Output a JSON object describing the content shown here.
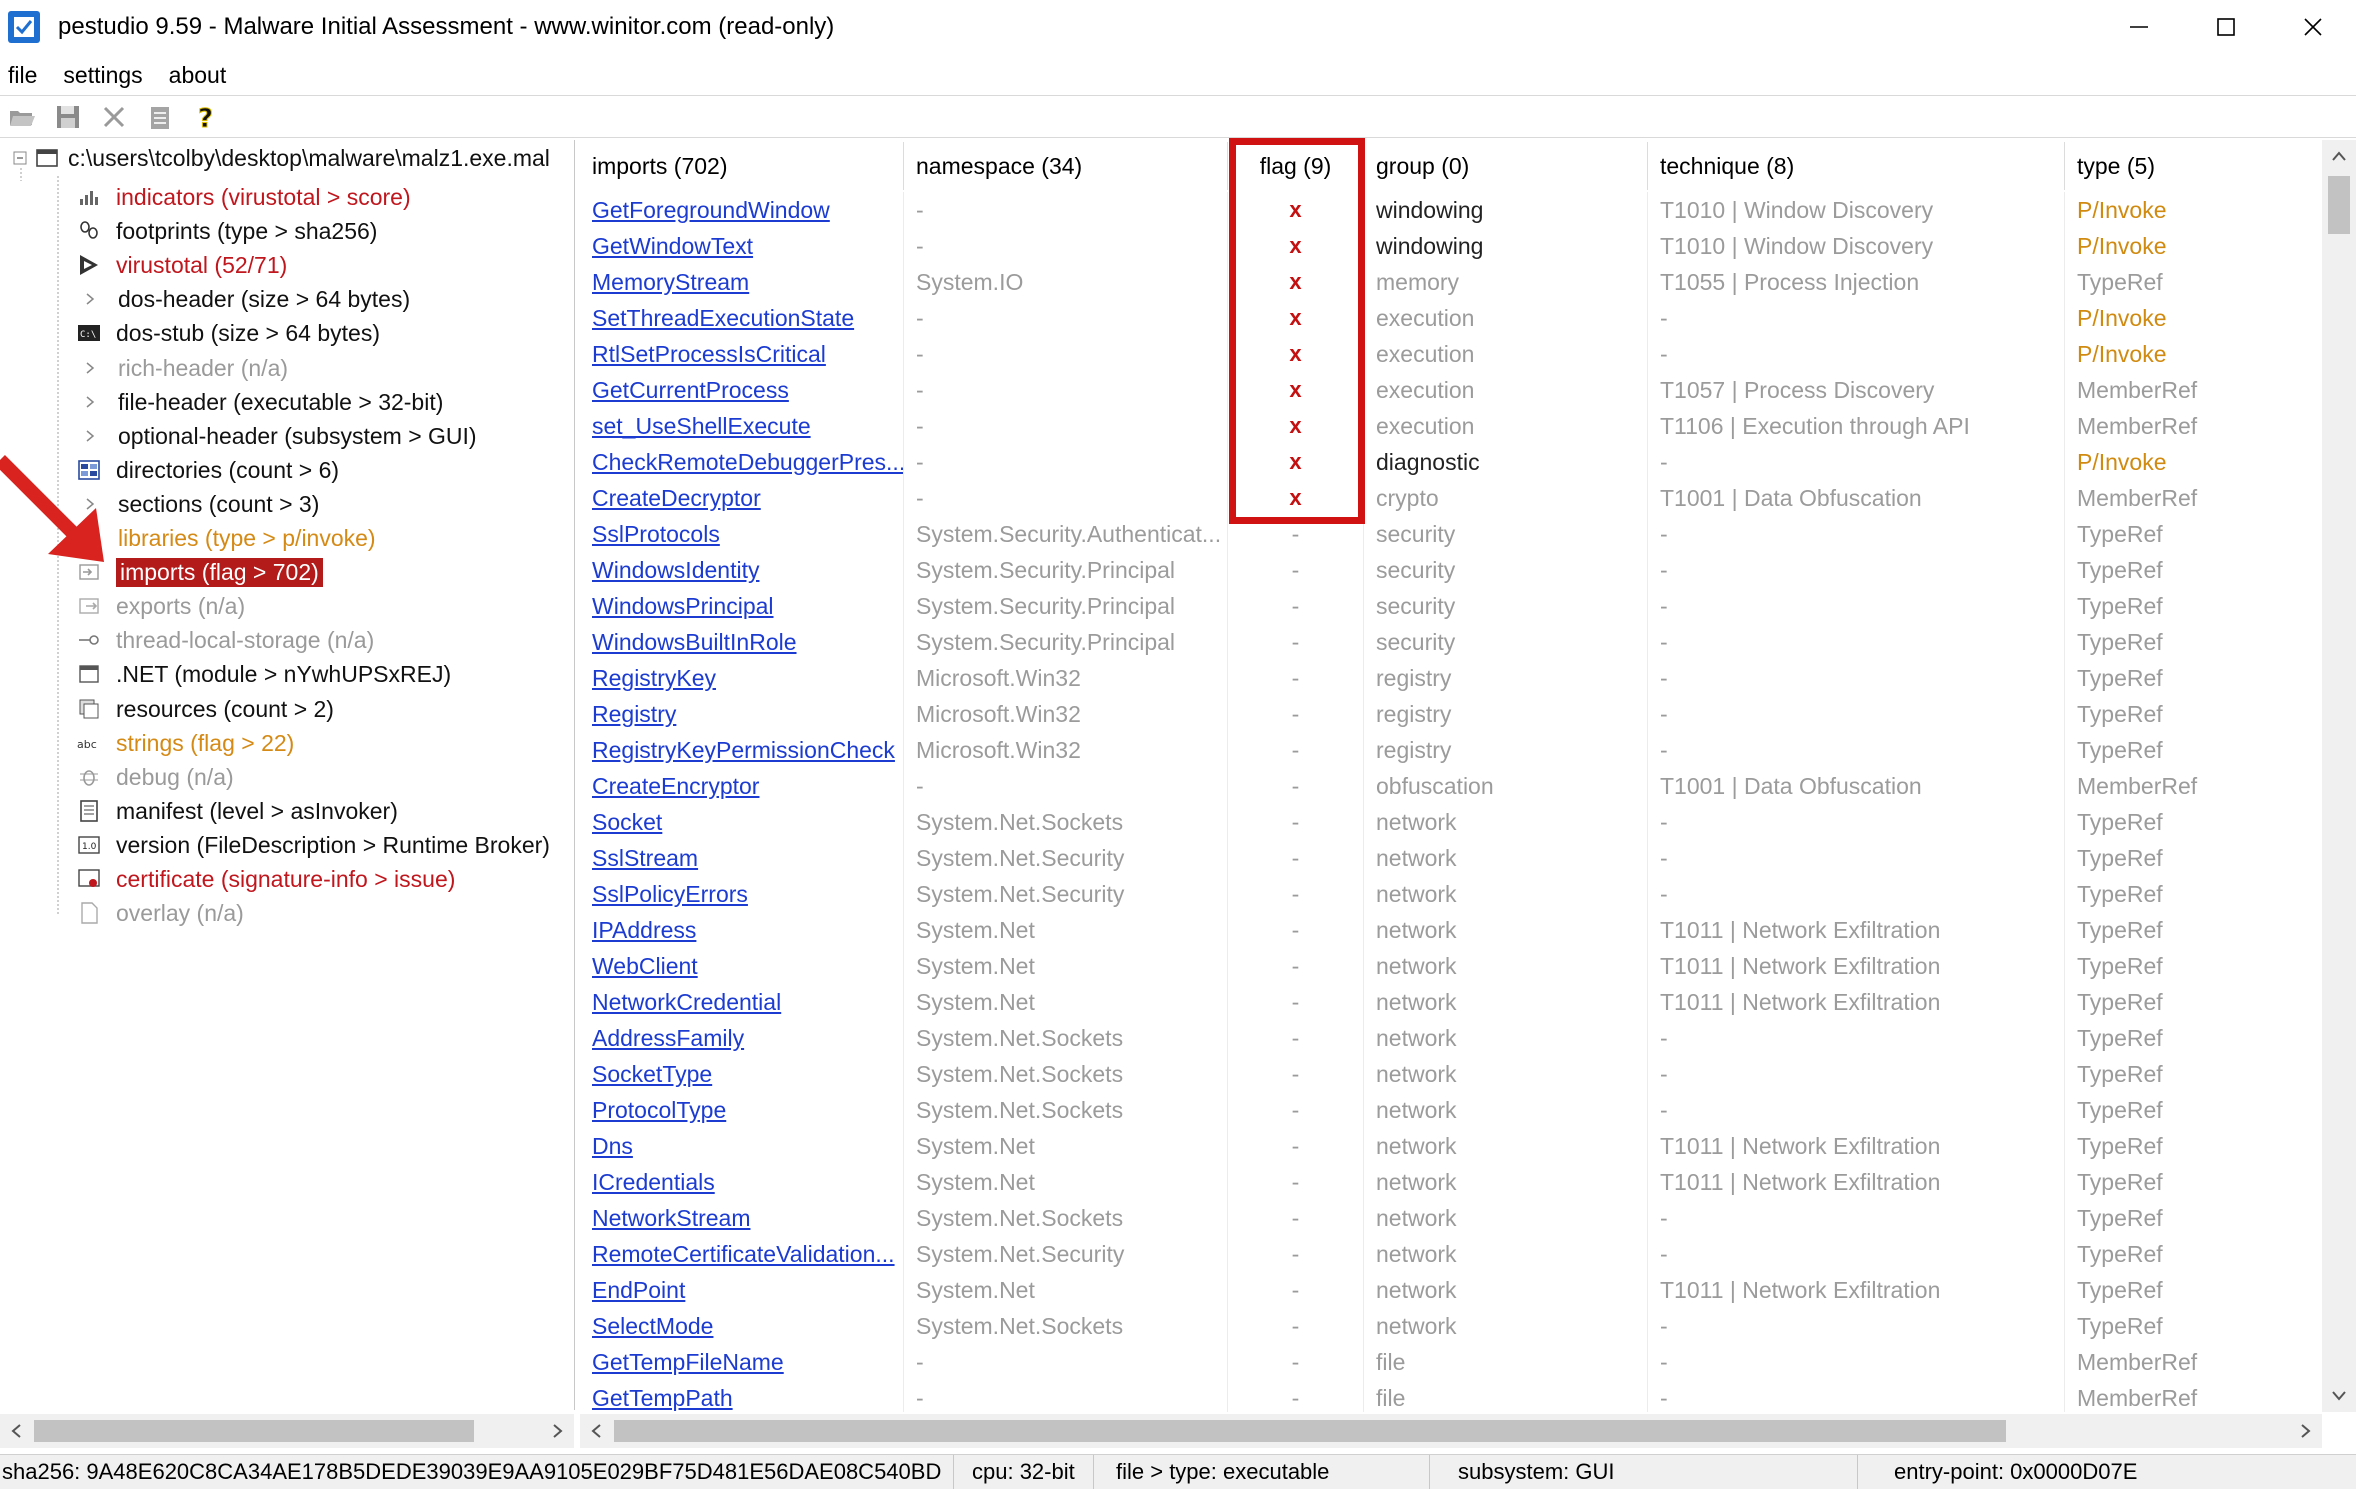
{
  "window": {
    "title": "pestudio 9.59 - Malware Initial Assessment - www.winitor.com (read-only)"
  },
  "menu": [
    "file",
    "settings",
    "about"
  ],
  "tree": {
    "root": "c:\\users\\tcolby\\desktop\\malware\\malz1.exe.mal",
    "items": [
      {
        "label": "indicators (virustotal > score)",
        "style": "red",
        "icon": "indicators-icon",
        "expander": false
      },
      {
        "label": "footprints (type > sha256)",
        "style": "black",
        "icon": "footprints-icon",
        "expander": false
      },
      {
        "label": "virustotal (52/71)",
        "style": "red",
        "icon": "virustotal-icon",
        "expander": false
      },
      {
        "label": "dos-header (size > 64 bytes)",
        "style": "black",
        "icon": "",
        "expander": true
      },
      {
        "label": "dos-stub (size > 64 bytes)",
        "style": "black",
        "icon": "dos-stub-icon",
        "expander": false
      },
      {
        "label": "rich-header (n/a)",
        "style": "gray",
        "icon": "",
        "expander": true
      },
      {
        "label": "file-header (executable > 32-bit)",
        "style": "black",
        "icon": "",
        "expander": true
      },
      {
        "label": "optional-header (subsystem > GUI)",
        "style": "black",
        "icon": "",
        "expander": true
      },
      {
        "label": "directories (count > 6)",
        "style": "black",
        "icon": "directories-icon",
        "expander": false
      },
      {
        "label": "sections (count > 3)",
        "style": "black",
        "icon": "",
        "expander": true
      },
      {
        "label": "libraries (type > p/invoke)",
        "style": "orange",
        "icon": "",
        "expander": true
      },
      {
        "label": "imports (flag > 702)",
        "style": "selected",
        "icon": "imports-icon",
        "expander": false
      },
      {
        "label": "exports (n/a)",
        "style": "gray",
        "icon": "exports-icon",
        "expander": false
      },
      {
        "label": "thread-local-storage (n/a)",
        "style": "gray",
        "icon": "tls-icon",
        "expander": false
      },
      {
        "label": ".NET (module > nYwhUPSxREJ)",
        "style": "black",
        "icon": "dotnet-icon",
        "expander": false
      },
      {
        "label": "resources (count > 2)",
        "style": "black",
        "icon": "resources-icon",
        "expander": false
      },
      {
        "label": "strings (flag > 22)",
        "style": "orange",
        "icon": "strings-icon",
        "expander": false
      },
      {
        "label": "debug (n/a)",
        "style": "gray",
        "icon": "debug-icon",
        "expander": false
      },
      {
        "label": "manifest (level > asInvoker)",
        "style": "black",
        "icon": "manifest-icon",
        "expander": false
      },
      {
        "label": "version (FileDescription > Runtime Broker)",
        "style": "black",
        "icon": "version-icon",
        "expander": false
      },
      {
        "label": "certificate (signature-info > issue)",
        "style": "red",
        "icon": "certificate-icon",
        "expander": false
      },
      {
        "label": "overlay (n/a)",
        "style": "gray",
        "icon": "overlay-icon",
        "expander": false
      }
    ]
  },
  "table": {
    "headers": [
      "imports (702)",
      "namespace (34)",
      "flag (9)",
      "group (0)",
      "technique (8)",
      "type (5)"
    ],
    "rows": [
      {
        "import": "GetForegroundWindow",
        "namespace": "-",
        "flag": "x",
        "group": "windowing",
        "group_dark": true,
        "technique": "T1010 | Window Discovery",
        "type": "P/Invoke"
      },
      {
        "import": "GetWindowText",
        "namespace": "-",
        "flag": "x",
        "group": "windowing",
        "group_dark": true,
        "technique": "T1010 | Window Discovery",
        "type": "P/Invoke"
      },
      {
        "import": "MemoryStream",
        "namespace": "System.IO",
        "flag": "x",
        "group": "memory",
        "group_dark": false,
        "technique": "T1055 | Process Injection",
        "type": "TypeRef"
      },
      {
        "import": "SetThreadExecutionState",
        "namespace": "-",
        "flag": "x",
        "group": "execution",
        "group_dark": false,
        "technique": "-",
        "type": "P/Invoke"
      },
      {
        "import": "RtlSetProcessIsCritical",
        "namespace": "-",
        "flag": "x",
        "group": "execution",
        "group_dark": false,
        "technique": "-",
        "type": "P/Invoke"
      },
      {
        "import": "GetCurrentProcess",
        "namespace": "-",
        "flag": "x",
        "group": "execution",
        "group_dark": false,
        "technique": "T1057 | Process Discovery",
        "type": "MemberRef"
      },
      {
        "import": "set_UseShellExecute",
        "namespace": "-",
        "flag": "x",
        "group": "execution",
        "group_dark": false,
        "technique": "T1106 | Execution through API",
        "type": "MemberRef"
      },
      {
        "import": "CheckRemoteDebuggerPres...",
        "namespace": "-",
        "flag": "x",
        "group": "diagnostic",
        "group_dark": true,
        "technique": "-",
        "type": "P/Invoke"
      },
      {
        "import": "CreateDecryptor",
        "namespace": "-",
        "flag": "x",
        "group": "crypto",
        "group_dark": false,
        "technique": "T1001 | Data Obfuscation",
        "type": "MemberRef"
      },
      {
        "import": "SslProtocols",
        "namespace": "System.Security.Authenticat...",
        "flag": "-",
        "group": "security",
        "group_dark": false,
        "technique": "-",
        "type": "TypeRef"
      },
      {
        "import": "WindowsIdentity",
        "namespace": "System.Security.Principal",
        "flag": "-",
        "group": "security",
        "group_dark": false,
        "technique": "-",
        "type": "TypeRef"
      },
      {
        "import": "WindowsPrincipal",
        "namespace": "System.Security.Principal",
        "flag": "-",
        "group": "security",
        "group_dark": false,
        "technique": "-",
        "type": "TypeRef"
      },
      {
        "import": "WindowsBuiltInRole",
        "namespace": "System.Security.Principal",
        "flag": "-",
        "group": "security",
        "group_dark": false,
        "technique": "-",
        "type": "TypeRef"
      },
      {
        "import": "RegistryKey",
        "namespace": "Microsoft.Win32",
        "flag": "-",
        "group": "registry",
        "group_dark": false,
        "technique": "-",
        "type": "TypeRef"
      },
      {
        "import": "Registry",
        "namespace": "Microsoft.Win32",
        "flag": "-",
        "group": "registry",
        "group_dark": false,
        "technique": "-",
        "type": "TypeRef"
      },
      {
        "import": "RegistryKeyPermissionCheck",
        "namespace": "Microsoft.Win32",
        "flag": "-",
        "group": "registry",
        "group_dark": false,
        "technique": "-",
        "type": "TypeRef"
      },
      {
        "import": "CreateEncryptor",
        "namespace": "-",
        "flag": "-",
        "group": "obfuscation",
        "group_dark": false,
        "technique": "T1001 | Data Obfuscation",
        "type": "MemberRef"
      },
      {
        "import": "Socket",
        "namespace": "System.Net.Sockets",
        "flag": "-",
        "group": "network",
        "group_dark": false,
        "technique": "-",
        "type": "TypeRef"
      },
      {
        "import": "SslStream",
        "namespace": "System.Net.Security",
        "flag": "-",
        "group": "network",
        "group_dark": false,
        "technique": "-",
        "type": "TypeRef"
      },
      {
        "import": "SslPolicyErrors",
        "namespace": "System.Net.Security",
        "flag": "-",
        "group": "network",
        "group_dark": false,
        "technique": "-",
        "type": "TypeRef"
      },
      {
        "import": "IPAddress",
        "namespace": "System.Net",
        "flag": "-",
        "group": "network",
        "group_dark": false,
        "technique": "T1011 | Network Exfiltration",
        "type": "TypeRef"
      },
      {
        "import": "WebClient",
        "namespace": "System.Net",
        "flag": "-",
        "group": "network",
        "group_dark": false,
        "technique": "T1011 | Network Exfiltration",
        "type": "TypeRef"
      },
      {
        "import": "NetworkCredential",
        "namespace": "System.Net",
        "flag": "-",
        "group": "network",
        "group_dark": false,
        "technique": "T1011 | Network Exfiltration",
        "type": "TypeRef"
      },
      {
        "import": "AddressFamily",
        "namespace": "System.Net.Sockets",
        "flag": "-",
        "group": "network",
        "group_dark": false,
        "technique": "-",
        "type": "TypeRef"
      },
      {
        "import": "SocketType",
        "namespace": "System.Net.Sockets",
        "flag": "-",
        "group": "network",
        "group_dark": false,
        "technique": "-",
        "type": "TypeRef"
      },
      {
        "import": "ProtocolType",
        "namespace": "System.Net.Sockets",
        "flag": "-",
        "group": "network",
        "group_dark": false,
        "technique": "-",
        "type": "TypeRef"
      },
      {
        "import": "Dns",
        "namespace": "System.Net",
        "flag": "-",
        "group": "network",
        "group_dark": false,
        "technique": "T1011 | Network Exfiltration",
        "type": "TypeRef"
      },
      {
        "import": "ICredentials",
        "namespace": "System.Net",
        "flag": "-",
        "group": "network",
        "group_dark": false,
        "technique": "T1011 | Network Exfiltration",
        "type": "TypeRef"
      },
      {
        "import": "NetworkStream",
        "namespace": "System.Net.Sockets",
        "flag": "-",
        "group": "network",
        "group_dark": false,
        "technique": "-",
        "type": "TypeRef"
      },
      {
        "import": "RemoteCertificateValidation...",
        "namespace": "System.Net.Security",
        "flag": "-",
        "group": "network",
        "group_dark": false,
        "technique": "-",
        "type": "TypeRef"
      },
      {
        "import": "EndPoint",
        "namespace": "System.Net",
        "flag": "-",
        "group": "network",
        "group_dark": false,
        "technique": "T1011 | Network Exfiltration",
        "type": "TypeRef"
      },
      {
        "import": "SelectMode",
        "namespace": "System.Net.Sockets",
        "flag": "-",
        "group": "network",
        "group_dark": false,
        "technique": "-",
        "type": "TypeRef"
      },
      {
        "import": "GetTempFileName",
        "namespace": "-",
        "flag": "-",
        "group": "file",
        "group_dark": false,
        "technique": "-",
        "type": "MemberRef"
      },
      {
        "import": "GetTempPath",
        "namespace": "-",
        "flag": "-",
        "group": "file",
        "group_dark": false,
        "technique": "-",
        "type": "MemberRef"
      }
    ]
  },
  "status": {
    "sha256": "sha256: 9A48E620C8CA34AE178B5DEDE39039E9AA9105E029BF75D481E56DAE08C540BD",
    "cpu": "cpu: 32-bit",
    "file": "file > type: executable",
    "subsystem": "subsystem: GUI",
    "entry": "entry-point: 0x0000D07E"
  },
  "colors": {
    "accent_red": "#c0161d",
    "link_blue": "#1b3bd1",
    "pinvoke_orange": "#d08a10",
    "selection_bg": "#b31a1a",
    "highlight_box": "#d11212"
  }
}
